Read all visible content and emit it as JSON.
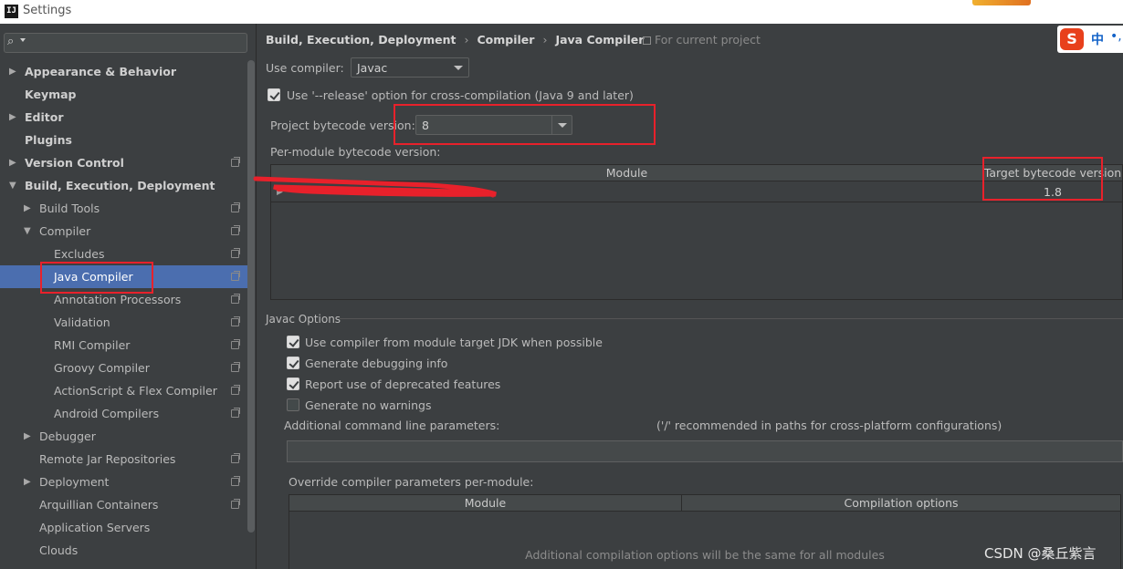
{
  "window": {
    "title": "Settings",
    "app_icon": "IJ"
  },
  "sidebar": {
    "search_icon": "search-icon",
    "items": [
      {
        "label": "Appearance & Behavior",
        "level": 0,
        "bold": true,
        "arrow": "▶",
        "project": false
      },
      {
        "label": "Keymap",
        "level": 0,
        "bold": true,
        "arrow": "",
        "project": false
      },
      {
        "label": "Editor",
        "level": 0,
        "bold": true,
        "arrow": "▶",
        "project": false
      },
      {
        "label": "Plugins",
        "level": 0,
        "bold": true,
        "arrow": "",
        "project": false
      },
      {
        "label": "Version Control",
        "level": 0,
        "bold": true,
        "arrow": "▶",
        "project": true
      },
      {
        "label": "Build, Execution, Deployment",
        "level": 0,
        "bold": true,
        "arrow": "▼",
        "project": false
      },
      {
        "label": "Build Tools",
        "level": 1,
        "bold": false,
        "arrow": "▶",
        "project": true
      },
      {
        "label": "Compiler",
        "level": 1,
        "bold": false,
        "arrow": "▼",
        "project": true
      },
      {
        "label": "Excludes",
        "level": 2,
        "bold": false,
        "arrow": "",
        "project": true
      },
      {
        "label": "Java Compiler",
        "level": 2,
        "bold": false,
        "arrow": "",
        "project": true,
        "selected": true
      },
      {
        "label": "Annotation Processors",
        "level": 2,
        "bold": false,
        "arrow": "",
        "project": true
      },
      {
        "label": "Validation",
        "level": 2,
        "bold": false,
        "arrow": "",
        "project": true
      },
      {
        "label": "RMI Compiler",
        "level": 2,
        "bold": false,
        "arrow": "",
        "project": true
      },
      {
        "label": "Groovy Compiler",
        "level": 2,
        "bold": false,
        "arrow": "",
        "project": true
      },
      {
        "label": "ActionScript & Flex Compiler",
        "level": 2,
        "bold": false,
        "arrow": "",
        "project": true
      },
      {
        "label": "Android Compilers",
        "level": 2,
        "bold": false,
        "arrow": "",
        "project": true
      },
      {
        "label": "Debugger",
        "level": 1,
        "bold": false,
        "arrow": "▶",
        "project": false
      },
      {
        "label": "Remote Jar Repositories",
        "level": 1,
        "bold": false,
        "arrow": "",
        "project": true
      },
      {
        "label": "Deployment",
        "level": 1,
        "bold": false,
        "arrow": "▶",
        "project": true
      },
      {
        "label": "Arquillian Containers",
        "level": 1,
        "bold": false,
        "arrow": "",
        "project": true
      },
      {
        "label": "Application Servers",
        "level": 1,
        "bold": false,
        "arrow": "",
        "project": false
      },
      {
        "label": "Clouds",
        "level": 1,
        "bold": false,
        "arrow": "",
        "project": false
      }
    ]
  },
  "breadcrumb": [
    "Build, Execution, Deployment",
    "Compiler",
    "Java Compiler"
  ],
  "breadcrumb_sep": "›",
  "for_project": "For current project",
  "ime": {
    "logo": "S",
    "lang": "中",
    "dots": "•,"
  },
  "use_compiler": {
    "label": "Use compiler:",
    "value": "Javac"
  },
  "release_option": {
    "label": "Use '--release' option for cross-compilation (Java 9 and later)",
    "checked": true
  },
  "project_bytecode": {
    "label": "Project bytecode version:",
    "value": "8"
  },
  "per_module": {
    "label": "Per-module bytecode version:",
    "columns": [
      "Module",
      "Target bytecode version"
    ],
    "rows": [
      {
        "module": "",
        "target": "1.8"
      }
    ]
  },
  "javac_options": {
    "title": "Javac Options",
    "checkboxes": [
      {
        "label": "Use compiler from module target JDK when possible",
        "checked": true
      },
      {
        "label": "Generate debugging info",
        "checked": true
      },
      {
        "label": "Report use of deprecated features",
        "checked": true
      },
      {
        "label": "Generate no warnings",
        "checked": false
      }
    ],
    "additional_label": "Additional command line parameters:",
    "additional_hint": "('/' recommended in paths for cross-platform configurations)",
    "additional_value": "",
    "override_label": "Override compiler parameters per-module:",
    "override_columns": [
      "Module",
      "Compilation options"
    ],
    "override_empty": "Additional compilation options will be the same for all modules"
  },
  "watermark": "CSDN @桑丘紫言",
  "colors": {
    "selection": "#4b6eaf",
    "annotation_red": "#e8212b",
    "bg": "#3c3f41"
  }
}
